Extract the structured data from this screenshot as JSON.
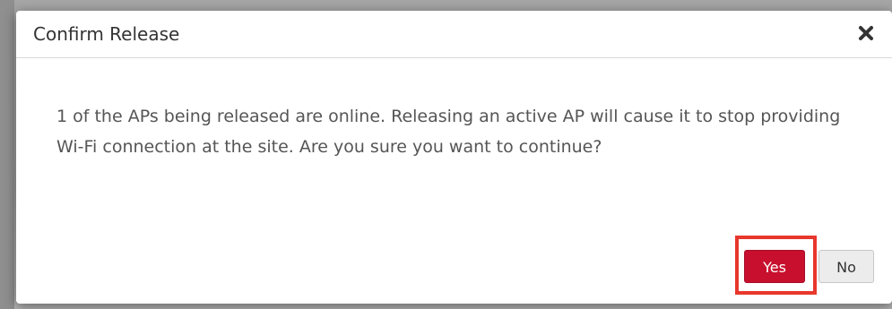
{
  "dialog": {
    "title": "Confirm Release",
    "message": "1 of the APs being released are online. Releasing an active AP will cause it to stop providing Wi-Fi connection at the site. Are you sure you want to continue?",
    "buttons": {
      "yes_label": "Yes",
      "no_label": "No"
    },
    "colors": {
      "primary": "#c8102e",
      "highlight": "#e8372c"
    },
    "icons": {
      "close": "close-icon"
    }
  }
}
